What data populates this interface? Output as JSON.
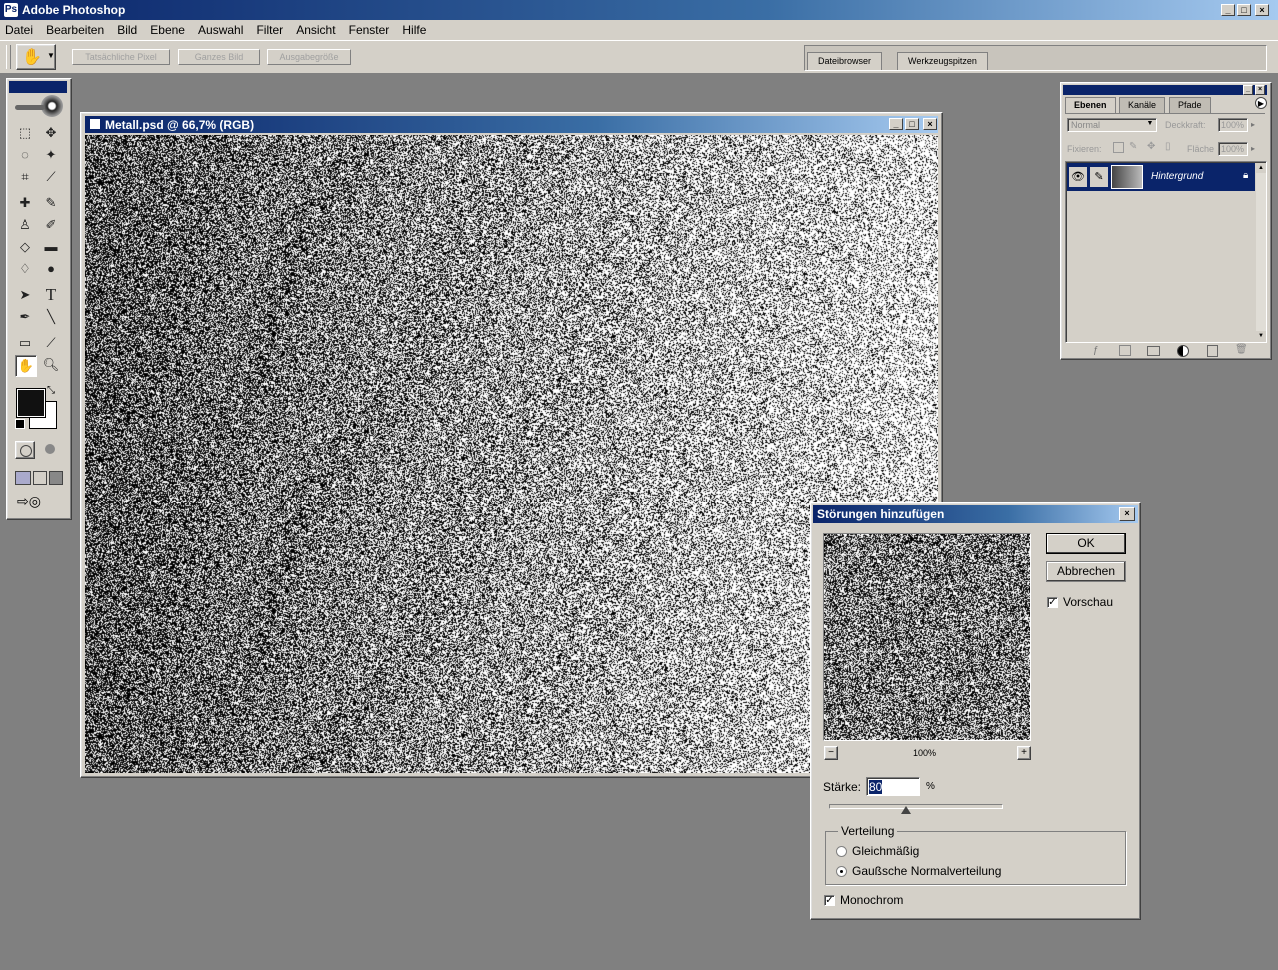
{
  "app": {
    "title": "Adobe Photoshop",
    "window_buttons": [
      "_",
      "□",
      "×"
    ]
  },
  "menu": [
    "Datei",
    "Bearbeiten",
    "Bild",
    "Ebene",
    "Auswahl",
    "Filter",
    "Ansicht",
    "Fenster",
    "Hilfe"
  ],
  "options": {
    "actual_pixels": "Tatsächliche Pixel",
    "fit_screen": "Ganzes Bild",
    "print_size": "Ausgabegröße",
    "well_tabs": [
      "Dateibrowser",
      "Werkzeugspitzen"
    ]
  },
  "document": {
    "title": "Metall.psd @ 66,7% (RGB)"
  },
  "layers_palette": {
    "tabs": [
      "Ebenen",
      "Kanäle",
      "Pfade"
    ],
    "blend_mode": "Normal",
    "opacity_label": "Deckkraft:",
    "opacity": "100%",
    "lock_label": "Fixieren:",
    "fill_label": "Fläche",
    "fill": "100%",
    "layer_name": "Hintergrund"
  },
  "dialog": {
    "title": "Störungen hinzufügen",
    "ok": "OK",
    "cancel": "Abbrechen",
    "preview_label": "Vorschau",
    "zoom": "100%",
    "amount_label": "Stärke:",
    "amount": "80",
    "amount_unit": "%",
    "amount_slider": 0.45,
    "group_label": "Verteilung",
    "uniform": "Gleichmäßig",
    "gaussian": "Gaußsche Normalverteilung",
    "monochrome": "Monochrom"
  },
  "colors": {
    "foreground": "#111111",
    "background": "#ffffff",
    "titlebar": "#0a246a",
    "workspace": "#808080"
  }
}
